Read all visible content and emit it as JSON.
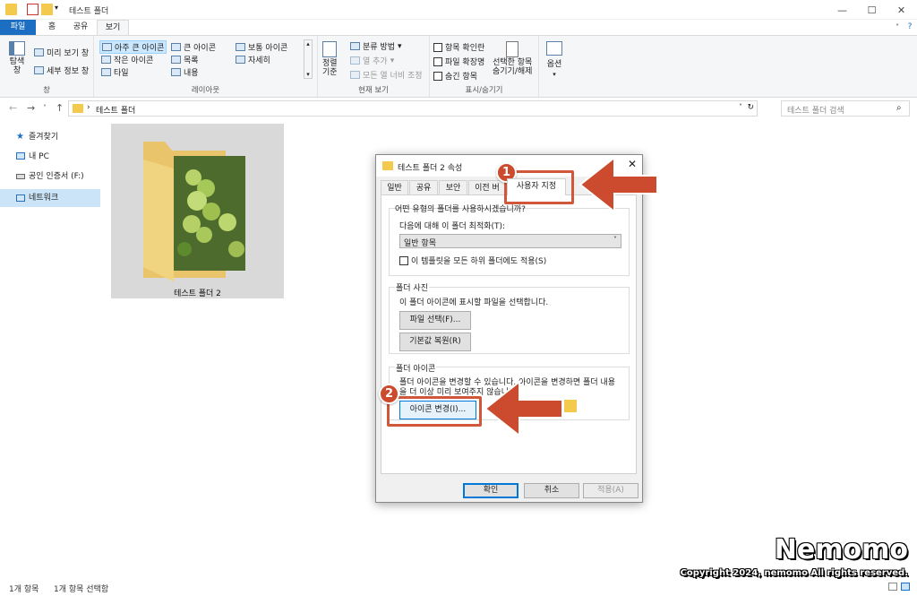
{
  "window": {
    "title": "테스트 폴더"
  },
  "ribbon_tabs": [
    "파일",
    "홈",
    "공유",
    "보기"
  ],
  "ribbon": {
    "panes": {
      "nav_pane": "탐색\n창",
      "preview": "미리 보기 창",
      "details": "세부 정보 창",
      "label": "창"
    },
    "layout": {
      "items": [
        "아주 큰 아이콘",
        "큰 아이콘",
        "보통 아이콘",
        "작은 아이콘",
        "목록",
        "자세히",
        "타일",
        "내용"
      ],
      "label": "레이아웃"
    },
    "current_view": {
      "sort": "정렬\n기준",
      "group": "분류 방법",
      "add_col": "열 추가",
      "fit_cols": "모든 열 너비 조정",
      "label": "현재 보기"
    },
    "show_hide": {
      "checkbox_labels": [
        "항목 확인란",
        "파일 확장명",
        "숨긴 항목"
      ],
      "hide_selected": "선택한 항목\n숨기기/해제",
      "label": "표시/숨기기"
    },
    "options": "옵션"
  },
  "address": {
    "path": "테스트 폴더",
    "search_placeholder": "테스트 폴더 검색"
  },
  "nav_pane": {
    "items": [
      "즐겨찾기",
      "내 PC",
      "공인 인증서 (F:)",
      "네트워크"
    ]
  },
  "content": {
    "folder_name": "테스트 폴더 2"
  },
  "status": {
    "count": "1개 항목",
    "selected": "1개 항목 선택함"
  },
  "dialog": {
    "title": "테스트 폴더 2 속성",
    "tabs": [
      "일반",
      "공유",
      "보안",
      "이전 버",
      "사용자 지정"
    ],
    "question": "어떤 유형의 폴더를 사용하시겠습니까?",
    "optimize_label": "다음에 대해 이 폴더 최적화(T):",
    "optimize_value": "일반 항목",
    "apply_sub": "이 템플릿을 모든 하위 폴더에도 적용(S)",
    "photo_group": "폴더 사진",
    "photo_desc": "이 폴더 아이콘에 표시할 파일을 선택합니다.",
    "choose_file": "파일 선택(F)...",
    "restore_default": "기본값 복원(R)",
    "icon_group": "폴더 아이콘",
    "icon_desc1": "폴더 아이콘을 변경할 수 있습니다. 아이콘을 변경하면 폴더 내용",
    "icon_desc2": "을 더 이상 미리 보여주지 않습니다.",
    "change_icon": "아이콘 변경(I)...",
    "ok": "확인",
    "cancel": "취소",
    "apply": "적용(A)"
  },
  "annotations": {
    "badge1": "1",
    "badge2": "2",
    "accent": "#cc4b2e"
  },
  "watermark": {
    "name": "Nemomo",
    "copyright": "Copyright 2024, nemomo All rights reserved."
  }
}
